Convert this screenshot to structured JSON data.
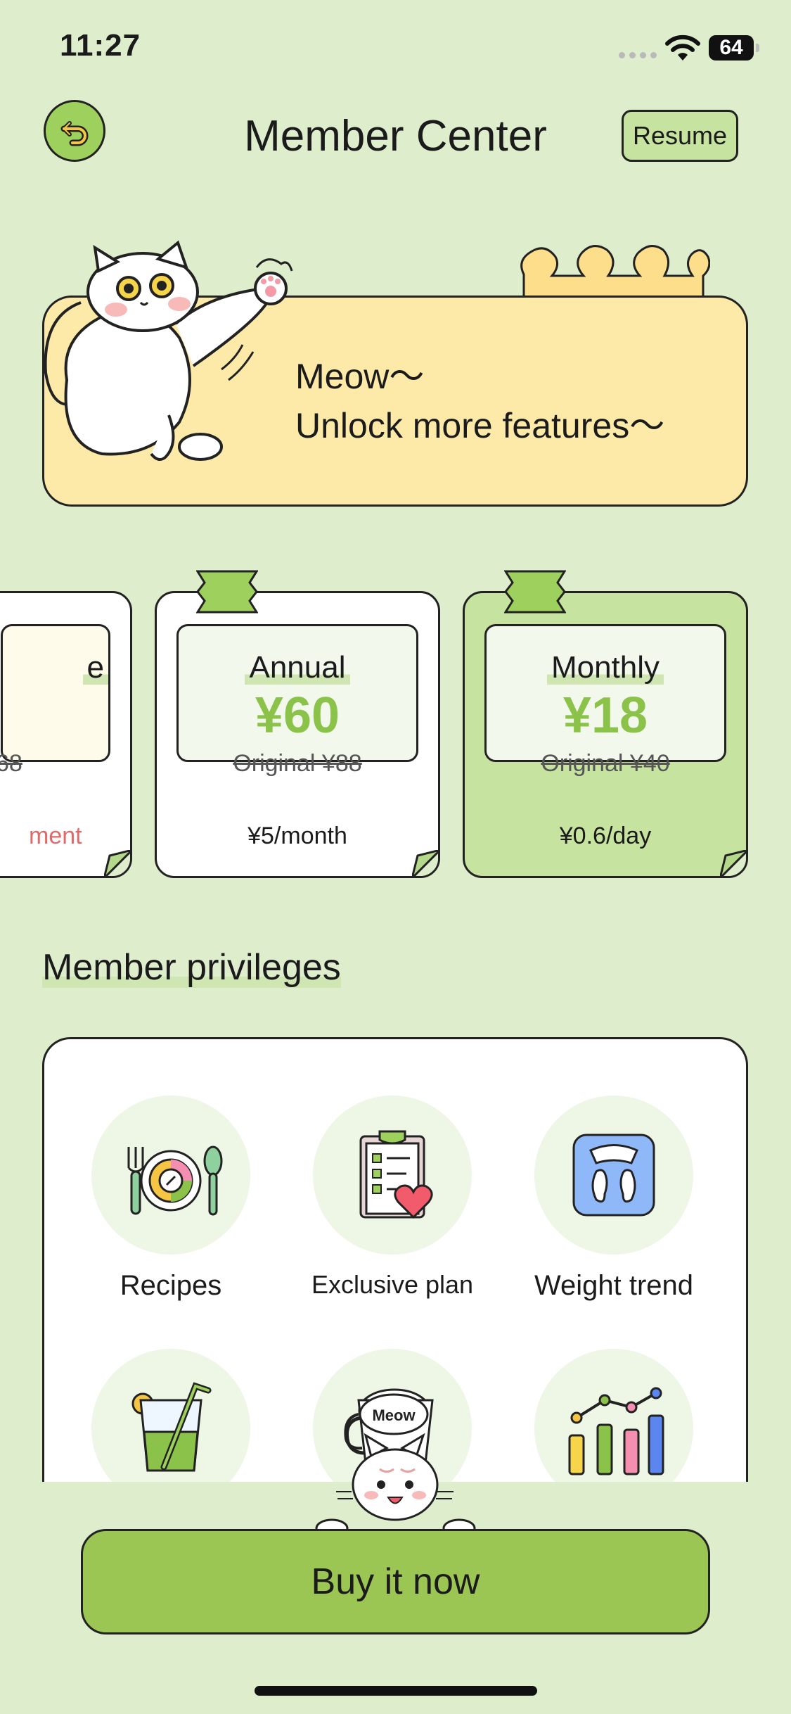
{
  "status_bar": {
    "time": "11:27",
    "battery": "64"
  },
  "header": {
    "title": "Member Center",
    "resume_label": "Resume"
  },
  "banner": {
    "line1": "Meow～",
    "line2": "Unlock more features～"
  },
  "plans": {
    "partial": {
      "name_fragment": "e",
      "orig_fragment": "68",
      "note_fragment": "ment"
    },
    "annual": {
      "name": "Annual",
      "price": "¥60",
      "original": "Original ¥88",
      "unit": "¥5/month"
    },
    "monthly": {
      "name": "Monthly",
      "price": "¥18",
      "original": "Original ¥40",
      "unit": "¥0.6/day"
    }
  },
  "privileges": {
    "title": "Member privileges",
    "items": [
      {
        "label": "Recipes",
        "icon": "recipes-plate-icon"
      },
      {
        "label": "Exclusive plan",
        "icon": "clipboard-heart-icon"
      },
      {
        "label": "Weight trend",
        "icon": "scale-icon"
      },
      {
        "label": "",
        "icon": "drink-glass-icon"
      },
      {
        "label": "",
        "icon": "meow-cup-icon"
      },
      {
        "label": "",
        "icon": "bar-chart-icon"
      }
    ]
  },
  "cat_speech": "Meow",
  "buy_label": "Buy it now",
  "colors": {
    "background": "#deedcc",
    "accent_green": "#8bc34a",
    "button_green": "#9cc653",
    "banner_yellow": "#fdeaa9",
    "note_red": "#e06a6a"
  }
}
